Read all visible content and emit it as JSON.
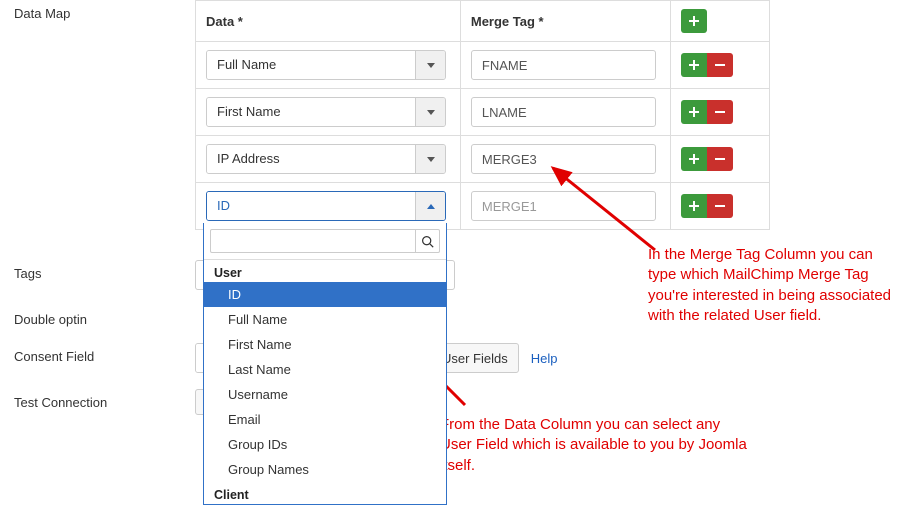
{
  "labels": {
    "data_map": "Data Map",
    "tags": "Tags",
    "double_optin": "Double optin",
    "consent_field": "Consent Field",
    "test_connection": "Test Connection"
  },
  "table": {
    "header_data": "Data *",
    "header_merge": "Merge Tag *",
    "rows": [
      {
        "data": "Full Name",
        "merge": "FNAME"
      },
      {
        "data": "First Name",
        "merge": "LNAME"
      },
      {
        "data": "IP Address",
        "merge": "MERGE3"
      },
      {
        "data": "ID",
        "merge_placeholder": "MERGE1"
      }
    ]
  },
  "dropdown": {
    "search_placeholder": "",
    "group1": "User",
    "items1": [
      "ID",
      "Full Name",
      "First Name",
      "Last Name",
      "Username",
      "Email",
      "Group IDs",
      "Group Names"
    ],
    "group2": "Client",
    "selected": "ID"
  },
  "consent": {
    "user_fields_btn": "User Fields",
    "help": "Help"
  },
  "annotations": {
    "merge": "In the Merge Tag Column you can type which MailChimp Merge Tag you're interested in being associated with the related User field.",
    "data": "From the Data Column you can select any User Field which is available to you by Joomla itself."
  }
}
